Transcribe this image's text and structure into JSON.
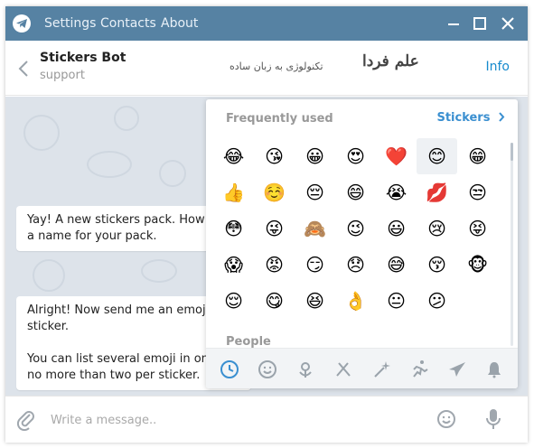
{
  "titlebar": {
    "menu": [
      "Settings",
      "Contacts",
      "About"
    ],
    "bg_color": "#5682a3"
  },
  "header": {
    "title": "Stickers Bot",
    "subtitle": "support",
    "watermark_main": "علم فردا",
    "watermark_sub": "تکنولوژی به زبان ساده",
    "info_label": "Info"
  },
  "messages": [
    {
      "lines": [
        "Yay! A new stickers pack. How are",
        "a name for your pack."
      ]
    },
    {
      "lines": [
        "Alright! Now send me an emoji th",
        "sticker.",
        "",
        "You can list several emoji in one m",
        "no more than two per sticker."
      ]
    }
  ],
  "emoji_panel": {
    "title": "Frequently used",
    "stickers_label": "Stickers",
    "section_people": "People",
    "selected_index": 5,
    "emojis": [
      "😂",
      "😘",
      "😀",
      "😍",
      "❤️",
      "😊",
      "😁",
      "👍",
      "☺️",
      "😔",
      "😄",
      "😭",
      "💋",
      "😒",
      "😳",
      "😜",
      "🙈",
      "😉",
      "😃",
      "😢",
      "😝",
      "😱",
      "😡",
      "😏",
      "😞",
      "😅",
      "😚",
      "🐵",
      "😌",
      "😋",
      "😆",
      "👌",
      "😐",
      "😕"
    ],
    "tabs": [
      "recent-icon",
      "smile-icon",
      "flower-icon",
      "food-icon",
      "magic-icon",
      "activity-icon",
      "plane-icon",
      "bell-icon"
    ]
  },
  "input": {
    "placeholder": "Write a message.."
  },
  "colors": {
    "accent": "#168acd",
    "chat_bg": "#dde3ea"
  }
}
